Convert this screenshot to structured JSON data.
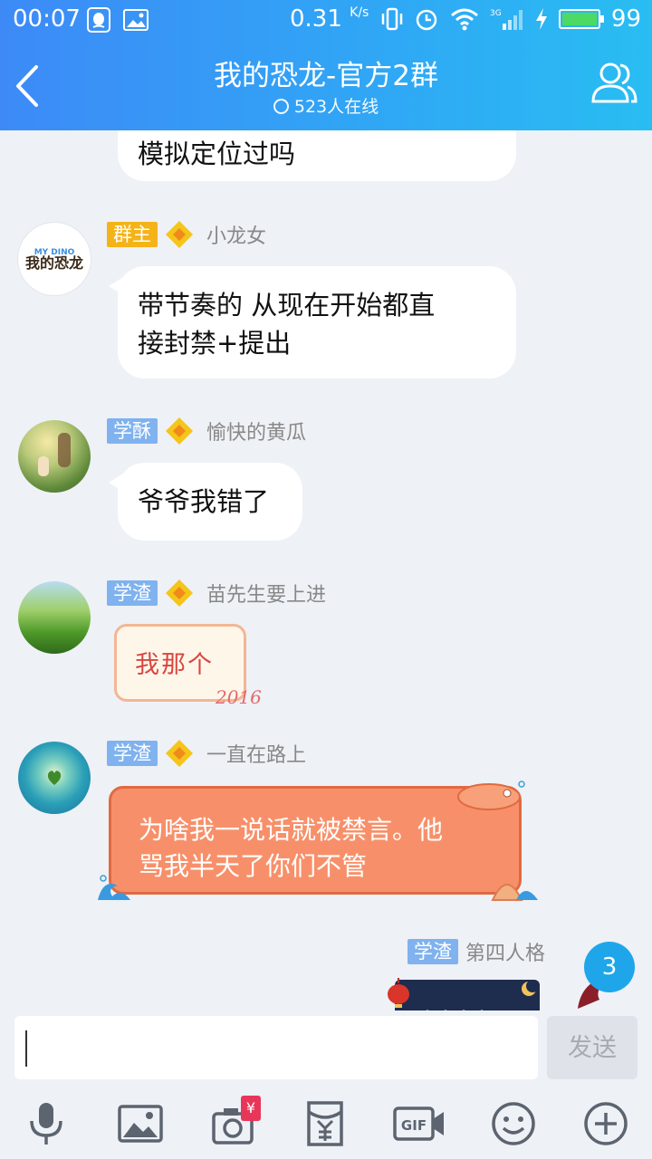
{
  "status": {
    "time": "00:07",
    "speed": "0.31",
    "speed_unit": "K/s",
    "battery": "99",
    "battery_level": 0.99,
    "net": "3G"
  },
  "header": {
    "title": "我的恐龙-官方2群",
    "online": "523人在线"
  },
  "messages": [
    {
      "text_lines": [
        "模拟定位过吗"
      ]
    },
    {
      "badge": "群主",
      "nick": "小龙女",
      "avatar_logo": "MY DINO 我的恐龙",
      "text_lines": [
        "带节奏的  从现在开始都直",
        "接封禁+提出"
      ]
    },
    {
      "badge": "学酥",
      "nick": "愉快的黄瓜",
      "text_lines": [
        "爷爷我错了"
      ]
    },
    {
      "badge": "学渣",
      "nick": "苗先生要上进",
      "sticker_text": "我那个",
      "sticker_year": "2016"
    },
    {
      "badge": "学渣",
      "nick": "一直在路上",
      "text_lines": [
        "为啥我一说话就被禁言。他",
        "骂我半天了你们不管"
      ]
    },
    {
      "badge": "学渣",
      "nick": "第四人格"
    }
  ],
  "unread_count": "3",
  "input": {
    "send_label": "发送"
  },
  "toolbar": {
    "icons": [
      "microphone-icon",
      "image-icon",
      "camera-icon",
      "red-envelope-icon",
      "gif-icon",
      "emoji-icon",
      "plus-icon"
    ],
    "camera_badge": "¥"
  },
  "colors": {
    "header_start": "#3d8af7",
    "header_end": "#29bdf2",
    "owner_badge": "#f5b31a",
    "member_badge": "#7fb2ee",
    "unread": "#1fa6ea"
  }
}
